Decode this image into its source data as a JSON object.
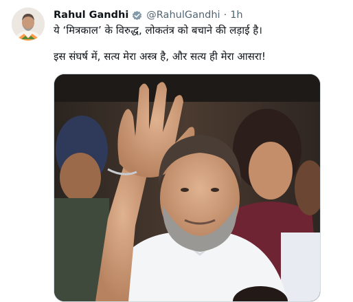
{
  "tweet": {
    "author": {
      "display_name": "Rahul Gandhi",
      "handle": "@RahulGandhi",
      "verified": true,
      "avatar_icon": "profile-avatar"
    },
    "separator": "·",
    "timestamp": "1h",
    "text_lines": [
      "ये ‘मित्रकाल’ के विरुद्ध, लोकतंत्र को बचाने की लड़ाई है।",
      "इस संघर्ष में, सत्य मेरा अस्त्र है, और सत्य ही मेरा आसरा!"
    ],
    "media": {
      "kind": "photo"
    }
  },
  "colors": {
    "text_primary": "#0f1419",
    "text_secondary": "#536471",
    "verified_badge": "#829aab",
    "media_border": "#cfd9de"
  }
}
